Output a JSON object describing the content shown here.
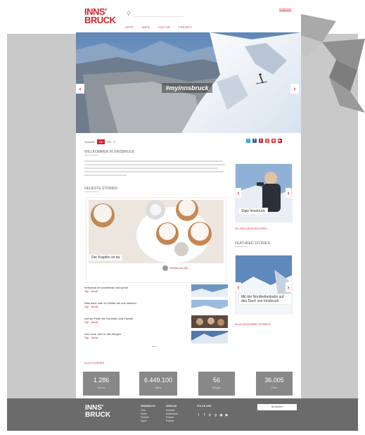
{
  "header": {
    "logo_line1": "INNS'",
    "logo_line2": "BRUCK",
    "search_placeholder": "",
    "top_link": "Innsbruck",
    "nav": [
      "Orte",
      "Wien",
      "Kultur",
      "Freizeit"
    ]
  },
  "hero": {
    "hashtag": "#myinnsbruck"
  },
  "toolbar": {
    "lang_label": "Sprache",
    "lang_options": [
      "DE",
      "EN",
      "IT"
    ],
    "lang_active": "DE"
  },
  "main": {
    "welcome_title": "Willkommen in Innsbruck",
    "recent_title": "Neueste Stories",
    "feature_caption": "Der Krapfen ist da",
    "feature_author": "Verfasst von Sigi"
  },
  "sidebar": {
    "card1_caption": "Sigis Innsbruck",
    "link1": "Zu den Geschichten",
    "featured_title": "Featured Stories",
    "card2_caption": "Mit der Nordkettenbahn auf das Dach von Innsbruck",
    "link2": "Alle Featured Stories"
  },
  "stories": [
    {
      "title": "Innsbruck ist wunderbar und schön",
      "meta": "Sigi · Januar"
    },
    {
      "title": "Was kann man im Winter bei uns machen",
      "meta": "Sigi · Januar"
    },
    {
      "title": "Auf der Piste mit Freunden und Familie",
      "meta": "Sigi · Januar"
    },
    {
      "title": "Das neue Jahr in den Bergen",
      "meta": "Sigi · Januar"
    }
  ],
  "more_link": "Alle Stories",
  "stats": [
    {
      "num": "1.286",
      "label": "Stories"
    },
    {
      "num": "6.449.100",
      "label": "Views"
    },
    {
      "num": "56",
      "label": "Blogger"
    },
    {
      "num": "36.005",
      "label": "Fans"
    }
  ],
  "footer": {
    "logo_line1": "INNS'",
    "logo_line2": "BRUCK",
    "col1_head": "Innsbruck",
    "col1_items": [
      "Orte",
      "Kultur",
      "Freizeit",
      "Sport"
    ],
    "col2_head": "Service",
    "col2_items": [
      "Kontakt",
      "Impressum",
      "Presse",
      "Partner"
    ],
    "col3_head": "Folge uns",
    "button": "Newsletter"
  },
  "colors": {
    "brand_red": "#d8232a",
    "gray": "#c9c9c9"
  }
}
